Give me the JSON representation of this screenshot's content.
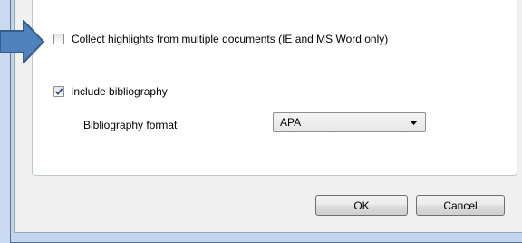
{
  "options": {
    "collect_highlights": {
      "label": "Collect highlights from multiple documents (IE and MS Word only)",
      "checked": false
    },
    "include_bibliography": {
      "label": "Include bibliography",
      "checked": true
    }
  },
  "bibliography_format": {
    "label": "Bibliography format",
    "selected": "APA"
  },
  "buttons": {
    "ok": "OK",
    "cancel": "Cancel"
  },
  "colors": {
    "pointer_arrow": "#4f81bd",
    "checkmark": "#2e4e89",
    "window_frame": "#c3d5ec",
    "dialog_background": "#f0f0f0"
  },
  "icons": {
    "pointer": "arrow-right-icon",
    "checkmark": "checkmark-icon",
    "dropdown": "chevron-down-icon"
  }
}
